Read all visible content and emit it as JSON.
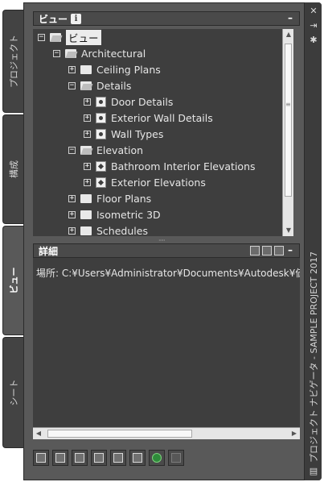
{
  "side_tabs": [
    {
      "label": "プロジェクト",
      "active": false
    },
    {
      "label": "構成",
      "active": false
    },
    {
      "label": "ビュー",
      "active": true
    },
    {
      "label": "シート",
      "active": false
    }
  ],
  "strip": {
    "close_icon": "close-icon",
    "pin_icon": "autohide-icon",
    "settings_icon": "properties-icon",
    "title": "プロジェクト ナビゲータ - SAMPLE PROJECT 2017",
    "bottom_icon": "palette-menu-icon"
  },
  "views_panel": {
    "title": "ビュー",
    "info_icon": "i",
    "minimize": "–"
  },
  "tree": [
    {
      "label": "ビュー",
      "level": 0,
      "expanded": true,
      "icon": "folder-open-icon",
      "selected": true
    },
    {
      "label": "Architectural",
      "level": 1,
      "expanded": true,
      "icon": "folder-open-icon"
    },
    {
      "label": "Ceiling Plans",
      "level": 2,
      "expanded": false,
      "icon": "folder-icon"
    },
    {
      "label": "Details",
      "level": 2,
      "expanded": true,
      "icon": "folder-open-icon"
    },
    {
      "label": "Door Details",
      "level": 3,
      "expanded": false,
      "icon": "detail-view-icon"
    },
    {
      "label": "Exterior Wall Details",
      "level": 3,
      "expanded": false,
      "icon": "detail-view-icon"
    },
    {
      "label": "Wall Types",
      "level": 3,
      "expanded": false,
      "icon": "detail-view-icon"
    },
    {
      "label": "Elevation",
      "level": 2,
      "expanded": true,
      "icon": "folder-open-icon"
    },
    {
      "label": "Bathroom Interior Elevations",
      "level": 3,
      "expanded": false,
      "icon": "elevation-view-icon"
    },
    {
      "label": "Exterior Elevations",
      "level": 3,
      "expanded": false,
      "icon": "elevation-view-icon"
    },
    {
      "label": "Floor Plans",
      "level": 2,
      "expanded": false,
      "icon": "folder-icon"
    },
    {
      "label": "Isometric 3D",
      "level": 2,
      "expanded": false,
      "icon": "folder-icon"
    },
    {
      "label": "Schedules",
      "level": 2,
      "expanded": false,
      "icon": "folder-icon"
    }
  ],
  "details_panel": {
    "title": "詳細",
    "location": "場所: C:¥Users¥Administrator¥Documents¥Autodesk¥価",
    "minimize": "–"
  },
  "toolbar": [
    {
      "name": "add-view-icon"
    },
    {
      "name": "add-detail-view-icon"
    },
    {
      "name": "add-section-view-icon"
    },
    {
      "name": "add-category-icon"
    },
    {
      "name": "regenerate-icon"
    },
    {
      "name": "properties-icon"
    },
    {
      "name": "refresh-icon"
    },
    {
      "name": "repath-icon",
      "disabled": true
    }
  ]
}
